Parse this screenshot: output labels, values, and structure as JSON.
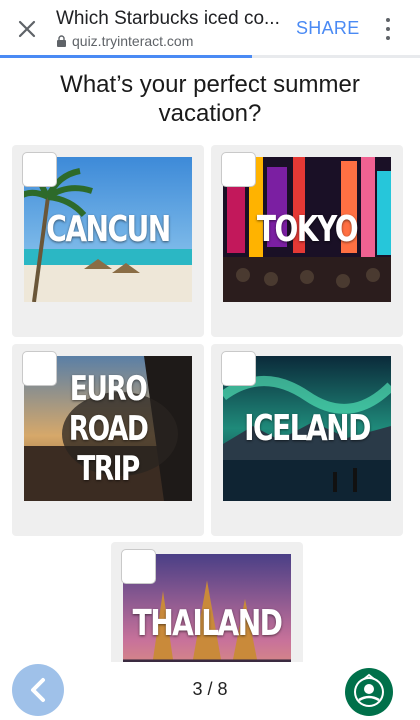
{
  "browser": {
    "title": "Which Starbucks iced co...",
    "url": "quiz.tryinteract.com",
    "share_label": "SHARE",
    "close_icon": "close-icon",
    "lock_icon": "lock-icon",
    "more_icon": "more-vert-icon",
    "load_progress": 0.6
  },
  "quiz": {
    "question": "What’s your perfect summer vacation?",
    "answers": [
      {
        "label": "CANCUN",
        "selected": false
      },
      {
        "label": "TOKYO",
        "selected": false
      },
      {
        "label": "EURO\nROAD TRIP",
        "selected": false
      },
      {
        "label": "ICELAND",
        "selected": false
      },
      {
        "label": "THAILAND",
        "selected": false
      }
    ]
  },
  "footer": {
    "back_icon": "chevron-left-icon",
    "counter": "3 / 8",
    "logo": "starbucks-logo"
  },
  "colors": {
    "accent": "#4a8af4",
    "tile_bg": "#efefef",
    "back_button": "#8fb7e6",
    "starbucks_green": "#00704a"
  }
}
